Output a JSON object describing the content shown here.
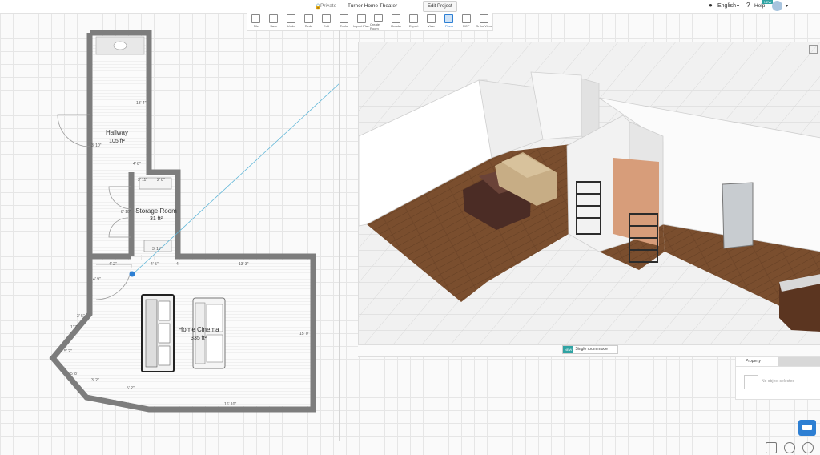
{
  "header": {
    "privacy": "Private",
    "project_name": "Turner Home Theater",
    "edit_project": "Edit Project",
    "language": "English",
    "help": "Help",
    "help_badge": "NEW"
  },
  "toolbar": {
    "items": [
      {
        "label": "File",
        "icon": "file-icon"
      },
      {
        "label": "Save",
        "icon": "save-icon"
      },
      {
        "label": "Undo",
        "icon": "undo-icon"
      },
      {
        "label": "Redo",
        "icon": "redo-icon"
      },
      {
        "label": "Edit",
        "icon": "edit-icon"
      },
      {
        "label": "Tools",
        "icon": "tools-icon"
      },
      {
        "label": "Import Plan",
        "icon": "import-plan-icon"
      },
      {
        "label": "Create Room",
        "icon": "create-room-icon"
      },
      {
        "label": "Render",
        "icon": "render-icon"
      },
      {
        "label": "Export",
        "icon": "export-icon"
      },
      {
        "label": "View",
        "icon": "view-icon"
      },
      {
        "label": "Plans",
        "icon": "plans-icon",
        "active": true
      },
      {
        "label": "RCP",
        "icon": "rcp-icon"
      },
      {
        "label": "Ortho View",
        "icon": "ortho-view-icon"
      }
    ]
  },
  "floorplan": {
    "rooms": [
      {
        "name": "Hallway",
        "area": "105 ft²"
      },
      {
        "name": "Storage Room",
        "area": "31 ft²"
      },
      {
        "name": "Home Cinema",
        "area": "335 ft²"
      }
    ],
    "dims": [
      "13' 4\"",
      "3' 10\"",
      "4' 8\"",
      "2' 8\"",
      "3' 11\"",
      "8' 10\"",
      "3' 11\"",
      "4' 2\"",
      "4' 5\"",
      "4'",
      "13' 3\"",
      "4' 9\"",
      "3' 5\"",
      "1' 7\"",
      "5' 2\"",
      "5' 8\"",
      "3' 2\"",
      "5' 2\"",
      "16' 10\"",
      "15' 0\""
    ]
  },
  "view3d": {
    "single_room_badge": "NEW",
    "single_room_mode": "Single room mode"
  },
  "property_panel": {
    "tab": "Property",
    "empty_message": "No object selected"
  },
  "colors": {
    "accent": "#2d7fd3",
    "wall": "#7d7d7d",
    "floor_wood": "#7a4e2e"
  }
}
